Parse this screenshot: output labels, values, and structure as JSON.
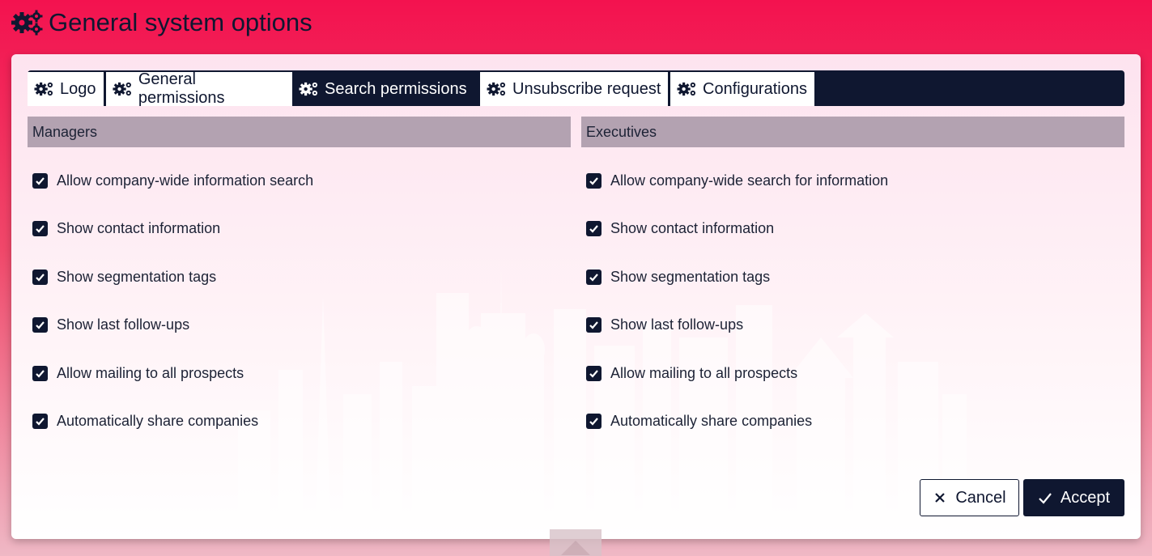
{
  "header": {
    "title": "General system options",
    "icon": "gears-icon"
  },
  "tabs": [
    {
      "label": "Logo",
      "icon": "gears-icon",
      "active": false
    },
    {
      "label": "General permissions",
      "icon": "gears-icon",
      "active": false
    },
    {
      "label": "Search permissions",
      "icon": "gears-icon",
      "active": true
    },
    {
      "label": "Unsubscribe request",
      "icon": "gears-icon",
      "active": false
    },
    {
      "label": "Configurations",
      "icon": "gears-icon",
      "active": false
    }
  ],
  "managers": {
    "title": "Managers",
    "options": [
      {
        "label": "Allow company-wide information search",
        "checked": true
      },
      {
        "label": "Show contact information",
        "checked": true
      },
      {
        "label": "Show segmentation tags",
        "checked": true
      },
      {
        "label": "Show last follow-ups",
        "checked": true
      },
      {
        "label": "Allow mailing to all prospects",
        "checked": true
      },
      {
        "label": "Automatically share companies",
        "checked": true
      }
    ]
  },
  "executives": {
    "title": "Executives",
    "options": [
      {
        "label": "Allow company-wide search for information",
        "checked": true
      },
      {
        "label": "Show contact information",
        "checked": true
      },
      {
        "label": "Show segmentation tags",
        "checked": true
      },
      {
        "label": "Show last follow-ups",
        "checked": true
      },
      {
        "label": "Allow mailing to all prospects",
        "checked": true
      },
      {
        "label": "Automatically share companies",
        "checked": true
      }
    ]
  },
  "actions": {
    "cancel_label": "Cancel",
    "accept_label": "Accept"
  },
  "colors": {
    "navy": "#0f1730",
    "header_gradient_top": "#f3124f",
    "column_header": "#b3a2b1"
  }
}
